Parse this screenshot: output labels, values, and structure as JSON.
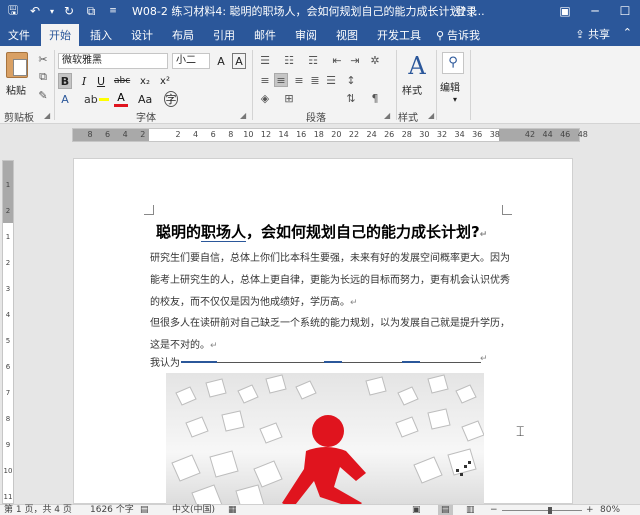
{
  "titlebar": {
    "title": "W08-2 练习材料4: 聪明的职场人，会如何规划自己的能力成长计划? [...",
    "login": "登录",
    "icons": [
      "save-icon",
      "undo-icon",
      "redo-icon",
      "touch-mode-icon",
      "customize-icon"
    ]
  },
  "tabs": [
    {
      "label": "文件"
    },
    {
      "label": "开始"
    },
    {
      "label": "插入"
    },
    {
      "label": "设计"
    },
    {
      "label": "布局"
    },
    {
      "label": "引用"
    },
    {
      "label": "邮件"
    },
    {
      "label": "审阅"
    },
    {
      "label": "视图"
    },
    {
      "label": "开发工具"
    }
  ],
  "tell_me": "告诉我",
  "share": "共享",
  "ribbon": {
    "paste_label": "粘贴",
    "clipboard_label": "剪贴板",
    "font_name": "微软雅黑",
    "font_size": "小二",
    "font_group_label": "字体",
    "paragraph_group_label": "段落",
    "style_label": "样式",
    "style_group_label": "样式",
    "edit_label": "编辑",
    "bold": "B",
    "italic": "I",
    "underline": "U",
    "strike": "abc",
    "sub": "x₂",
    "sup": "x²",
    "font_grow": "A",
    "font_shrink": "A",
    "clear_fmt": "A",
    "font_color": "A",
    "change_case": "Aa"
  },
  "ruler": {
    "numbers": [
      "8",
      "6",
      "4",
      "2",
      "",
      "2",
      "4",
      "6",
      "8",
      "10",
      "12",
      "14",
      "16",
      "18",
      "20",
      "22",
      "24",
      "26",
      "28",
      "30",
      "32",
      "34",
      "36",
      "38",
      "",
      "42",
      "44",
      "46",
      "48"
    ]
  },
  "vruler_numbers": [
    "1",
    "2",
    "1",
    "2",
    "3",
    "4",
    "5",
    "6",
    "7",
    "8",
    "9",
    "10",
    "11"
  ],
  "document": {
    "title_part1": "聪明的",
    "title_ul": "职场人",
    "title_part2": "，会如何规划自己的能力成长计划?",
    "lines": [
      "研究生们要自信，总体上你们比本科生要强，未来有好的发展空间概率更大。因为",
      "能考上研究生的人，总体上更自律，更能为长远的目标而努力，更有机会认识优秀",
      "的校友，而不仅仅是因为他成绩好，学历高。",
      "但很多人在读研前对自己缺乏一个系统的能力规划，以为发展自己就是提升学历，",
      "这是不对的。",
      "我认为"
    ]
  },
  "statusbar": {
    "page": "第 1 页，共 4 页",
    "words": "1626 个字",
    "lang": "中文(中国)",
    "zoom": "80%"
  },
  "colors": {
    "brand": "#2b579a",
    "figure_red": "#e0141e"
  }
}
